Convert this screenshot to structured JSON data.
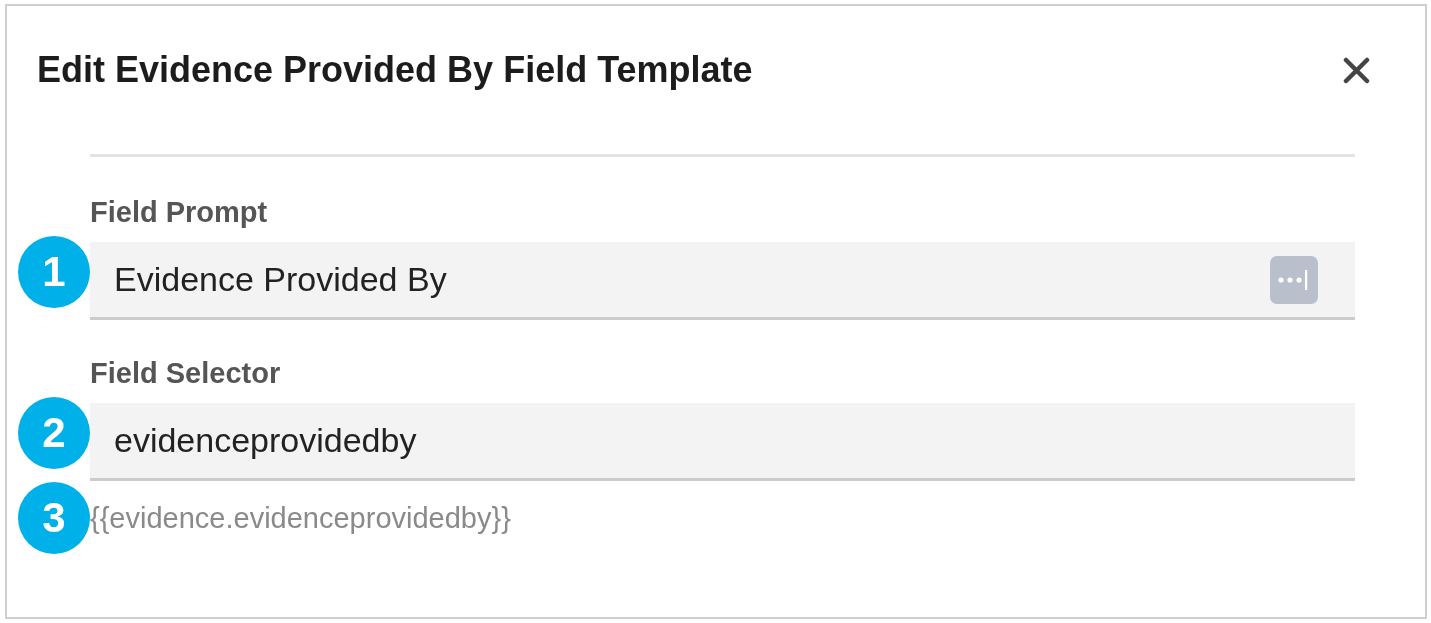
{
  "dialog": {
    "title": "Edit Evidence Provided By Field Template"
  },
  "fields": [
    {
      "kind": "with_menu",
      "label": "Field Prompt",
      "value": "Evidence Provided By",
      "callout": "1"
    },
    {
      "kind": "plain",
      "label": "Field Selector",
      "value": "evidenceprovidedby",
      "callout": "2"
    }
  ],
  "hint": {
    "text": "{{evidence.evidenceprovidedby}}",
    "callout": "3"
  }
}
